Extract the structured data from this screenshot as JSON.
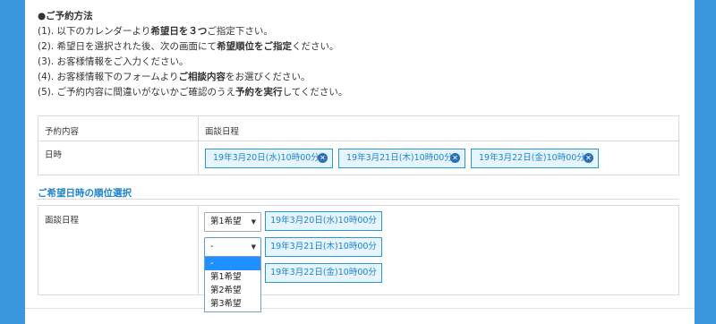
{
  "instructions": {
    "heading": "●ご予約方法",
    "lines": [
      {
        "pre": "(1). 以下のカレンダーより",
        "bold": "希望日を３つ",
        "post": "ご指定下さい。"
      },
      {
        "pre": "(2). 希望日を選択された後、次の画面にて",
        "bold": "希望順位をご指定",
        "post": "ください。"
      },
      {
        "pre": "(3). お客様情報をご入力ください。",
        "bold": "",
        "post": ""
      },
      {
        "pre": "(4). お客様情報下のフォームより",
        "bold": "ご相談内容",
        "post": "をお選びください。"
      },
      {
        "pre": "(5). ご予約内容に間違いがないかご確認のうえ",
        "bold": "予約を実行",
        "post": "してください。"
      }
    ]
  },
  "summary_table": {
    "col1_header": "予約内容",
    "col2_header": "面談日程",
    "row_label": "日時",
    "dates": [
      "19年3月20日(水)10時00分",
      "19年3月21日(木)10時00分",
      "19年3月22日(金)10時00分"
    ]
  },
  "ranking": {
    "title": "ご希望日時の順位選択",
    "row_label": "面談日程",
    "selects": [
      "第1希望",
      "-"
    ],
    "options": [
      "-",
      "第1希望",
      "第2希望",
      "第3希望"
    ],
    "highlighted_option": "-",
    "dates": [
      "19年3月20日(水)10時00分",
      "19年3月21日(木)10時00分",
      "19年3月22日(金)10時00分"
    ]
  },
  "icons": {
    "remove": "close-circle-icon",
    "dropdown": "caret-down-icon"
  },
  "colors": {
    "accent": "#1f83c9",
    "background": "#3a97dd",
    "chip_bg": "#e5f4fd"
  }
}
